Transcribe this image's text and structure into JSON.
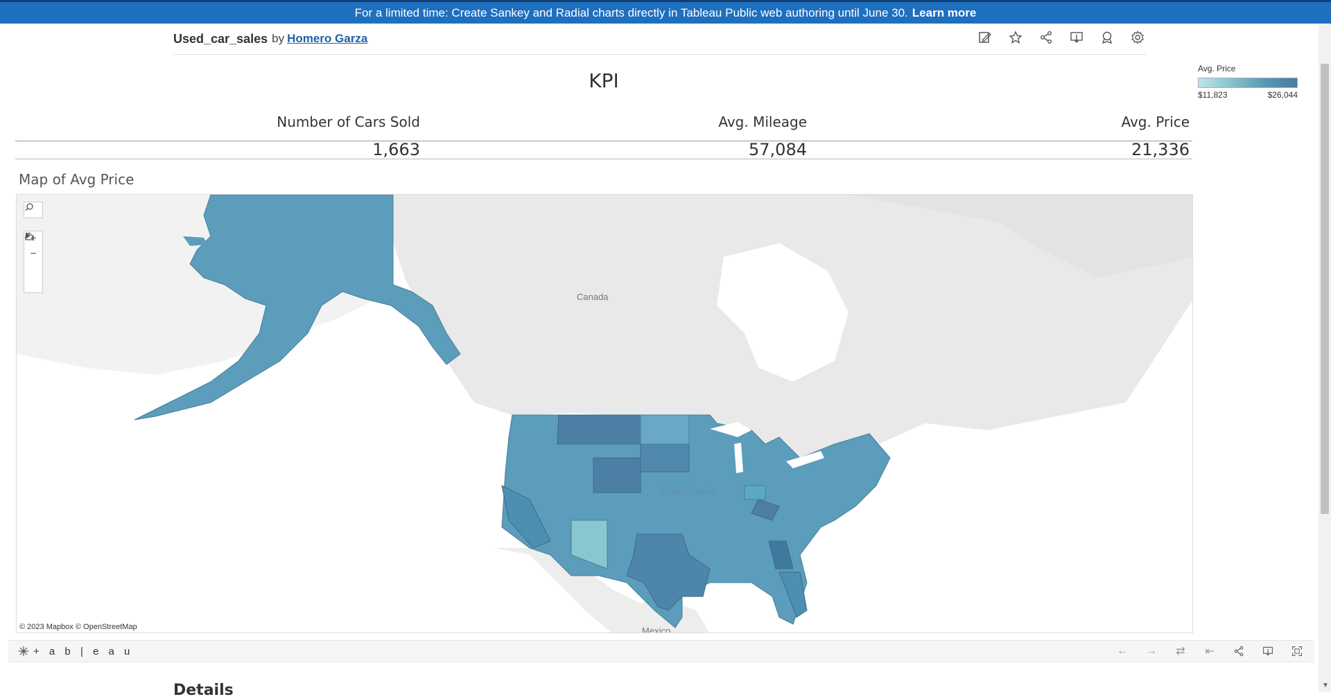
{
  "banner": {
    "text": "For a limited time: Create Sankey and Radial charts directly in Tableau Public web authoring until June 30.",
    "link": "Learn more"
  },
  "header": {
    "title": "Used_car_sales",
    "by": "by",
    "author": "Homero Garza"
  },
  "toolbar_icons": [
    "edit-icon",
    "favorite-star-icon",
    "share-icon",
    "download-icon",
    "badge-icon",
    "settings-gear-icon"
  ],
  "legend": {
    "title": "Avg. Price",
    "min": "$11,823",
    "max": "$26,044",
    "colors": [
      "#bfe6e6",
      "#4a7aa0"
    ]
  },
  "kpi": {
    "title": "KPI",
    "headers": [
      "Number of Cars Sold",
      "Avg. Mileage",
      "Avg. Price"
    ],
    "values": [
      "1,663",
      "57,084",
      "21,336"
    ]
  },
  "map": {
    "title": "Map of Avg Price",
    "labels": {
      "canada": "Canada",
      "us": "United States",
      "mexico": "Mexico"
    },
    "attribution": "© 2023 Mapbox  © OpenStreetMap",
    "controls": [
      "search-icon",
      "zoom-in-icon",
      "zoom-out-icon",
      "home-icon",
      "play-icon"
    ]
  },
  "footer": {
    "logo": "+ a b | e a u",
    "icons": [
      "undo-icon",
      "redo-icon",
      "revert-icon",
      "reset-icon",
      "share-icon",
      "download-icon",
      "fullscreen-icon"
    ]
  },
  "details": "Details"
}
